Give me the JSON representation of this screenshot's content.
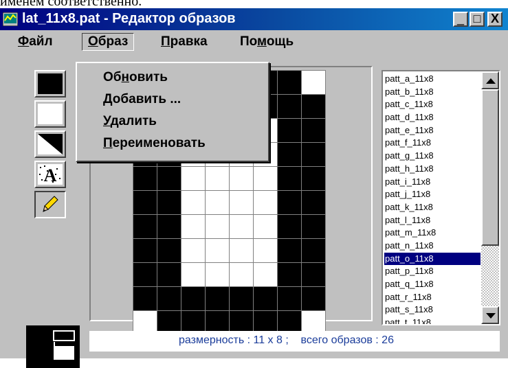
{
  "doc_fragment": "именем соответственно.",
  "window": {
    "title": "lat_11x8.pat - Редактор образов",
    "controls": {
      "minimize": "_",
      "maximize": "□",
      "close": "X"
    }
  },
  "menubar": {
    "file": {
      "underlined": "Ф",
      "rest": "айл"
    },
    "pattern": {
      "underlined": "О",
      "rest": "браз"
    },
    "edit": {
      "underlined": "П",
      "rest": "равка"
    },
    "help": {
      "pre": "По",
      "underlined": "м",
      "rest": "ощь"
    }
  },
  "dropdown": {
    "refresh": {
      "pre": "Об",
      "underlined": "н",
      "rest": "овить"
    },
    "add": {
      "underlined": "Д",
      "rest": "обавить ..."
    },
    "delete": {
      "underlined": "У",
      "rest": "далить"
    },
    "rename": {
      "underlined": "П",
      "rest": "ереименовать"
    }
  },
  "tools": [
    "fill-black",
    "fill-white",
    "fill-diagonal",
    "letter-a",
    "pencil"
  ],
  "pattern_grid": [
    "11111110",
    "11111111",
    "11000011",
    "11000011",
    "11000011",
    "11000011",
    "11000011",
    "11000011",
    "11000011",
    "11111111",
    "01111110"
  ],
  "pattern_list": {
    "items": [
      "patt_a_11x8",
      "patt_b_11x8",
      "patt_c_11x8",
      "patt_d_11x8",
      "patt_e_11x8",
      "patt_f_11x8",
      "patt_g_11x8",
      "patt_h_11x8",
      "patt_i_11x8",
      "patt_j_11x8",
      "patt_k_11x8",
      "patt_l_11x8",
      "patt_m_11x8",
      "patt_n_11x8",
      "patt_o_11x8",
      "patt_p_11x8",
      "patt_q_11x8",
      "patt_r_11x8",
      "patt_s_11x8",
      "patt_t_11x8"
    ],
    "selected_index": 14
  },
  "status": {
    "text": "размерность : 11 х 8 ;    всего образов : 26"
  },
  "colors": {
    "title_start": "#000080",
    "title_end": "#1084d0",
    "face": "#c0c0c0",
    "selection": "#000080",
    "status_text": "#1a3c9a"
  }
}
